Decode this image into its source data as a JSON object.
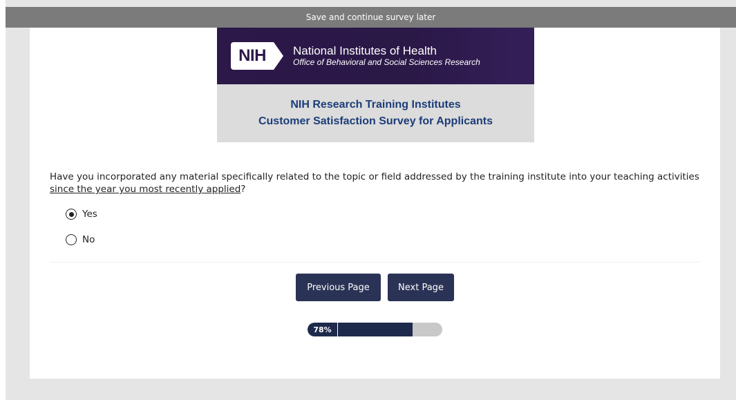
{
  "header": {
    "save_later_label": "Save and continue survey later"
  },
  "banner": {
    "logo_text": "NIH",
    "org_name": "National Institutes of Health",
    "office_name": "Office of Behavioral and Social Sciences Research",
    "title_line1": "NIH Research Training Institutes",
    "title_line2": "Customer Satisfaction Survey for Applicants"
  },
  "question": {
    "text_before": "Have you incorporated any material specifically related to the topic or field addressed by the training institute into your teaching activities ",
    "text_underlined": "since the year you most recently applied",
    "text_after": "?",
    "options": [
      {
        "label": "Yes",
        "selected": true
      },
      {
        "label": "No",
        "selected": false
      }
    ]
  },
  "navigation": {
    "previous_label": "Previous Page",
    "next_label": "Next Page"
  },
  "progress": {
    "label": "78%",
    "value": 78
  },
  "colors": {
    "topbar": "#7b7b7b",
    "banner_purple": "#2c1849",
    "banner_title": "#1c3d78",
    "button": "#2a3355",
    "progress_fill": "#1e2a4c"
  }
}
